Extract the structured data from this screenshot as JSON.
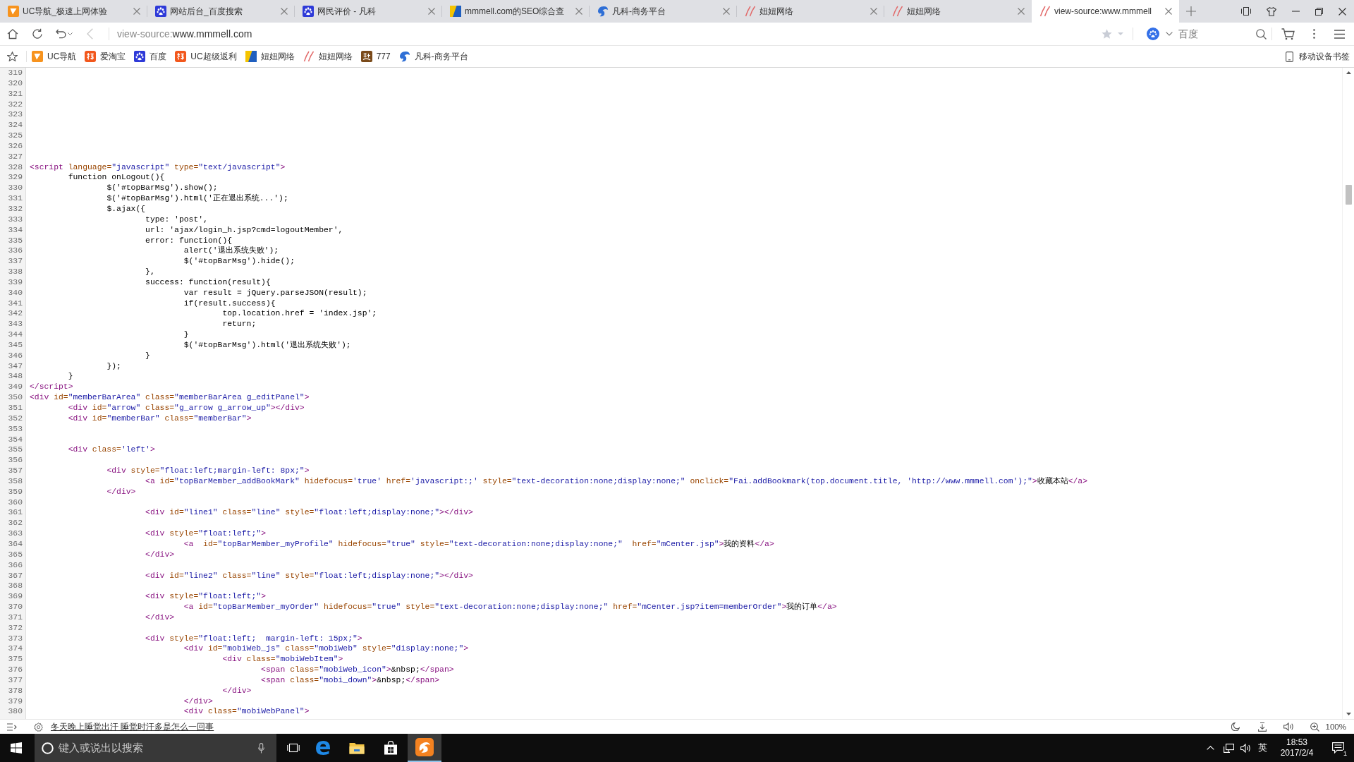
{
  "tabs": [
    {
      "title": "UC导航_极速上网体验",
      "selected": false
    },
    {
      "title": "网站后台_百度搜索",
      "selected": false
    },
    {
      "title": "网民评价 - 凡科",
      "selected": false
    },
    {
      "title": "mmmell.com的SEO综合查",
      "selected": false
    },
    {
      "title": "凡科-商务平台",
      "selected": false
    },
    {
      "title": "妞妞网络",
      "selected": false
    },
    {
      "title": "妞妞网络",
      "selected": false
    },
    {
      "title": "view-source:www.mmmell",
      "selected": true
    }
  ],
  "back_button": {
    "disabled": true
  },
  "address_bar": {
    "scheme": "view-source:",
    "host": "www.mmmell.com"
  },
  "page_star": {
    "bookmarked": false
  },
  "search_box": {
    "placeholder": "百度"
  },
  "bookmarks": [
    {
      "label": "UC导航"
    },
    {
      "label": "爱淘宝"
    },
    {
      "label": "百度"
    },
    {
      "label": "UC超级返利"
    },
    {
      "label": "妞妞网络"
    },
    {
      "label": "妞妞网络"
    },
    {
      "label": "777"
    },
    {
      "label": "凡科-商务平台"
    }
  ],
  "mobile_bookmarks": {
    "label": "移动设备书签"
  },
  "source_lines": [
    {
      "number": "319"
    },
    {
      "number": "320"
    },
    {
      "number": "321"
    },
    {
      "number": "322"
    },
    {
      "number": "323"
    },
    {
      "number": "324"
    },
    {
      "number": "325"
    },
    {
      "number": "326"
    },
    {
      "number": "327"
    },
    {
      "number": "328",
      "tokens": [
        {
          "kind": "tag",
          "text": "<script"
        },
        {
          "kind": "attr",
          "text": " language="
        },
        {
          "kind": "value",
          "text": "\"javascript\""
        },
        {
          "kind": "attr",
          "text": " type="
        },
        {
          "kind": "value",
          "text": "\"text/javascript\""
        },
        {
          "kind": "tag",
          "text": ">"
        }
      ]
    },
    {
      "number": "329",
      "tokens": [
        {
          "kind": "text",
          "text": "\tfunction onLogout(){"
        }
      ]
    },
    {
      "number": "330",
      "tokens": [
        {
          "kind": "text",
          "text": "\t\t$('#topBarMsg').show();"
        }
      ]
    },
    {
      "number": "331",
      "tokens": [
        {
          "kind": "text",
          "text": "\t\t$('#topBarMsg').html('正在退出系统...');"
        }
      ]
    },
    {
      "number": "332",
      "tokens": [
        {
          "kind": "text",
          "text": "\t\t$.ajax({"
        }
      ]
    },
    {
      "number": "333",
      "tokens": [
        {
          "kind": "text",
          "text": "\t\t\ttype: 'post',"
        }
      ]
    },
    {
      "number": "334",
      "tokens": [
        {
          "kind": "text",
          "text": "\t\t\turl: 'ajax/login_h.jsp?cmd=logoutMember',"
        }
      ]
    },
    {
      "number": "335",
      "tokens": [
        {
          "kind": "text",
          "text": "\t\t\terror: function(){"
        }
      ]
    },
    {
      "number": "336",
      "tokens": [
        {
          "kind": "text",
          "text": "\t\t\t\talert('退出系统失败');"
        }
      ]
    },
    {
      "number": "337",
      "tokens": [
        {
          "kind": "text",
          "text": "\t\t\t\t$('#topBarMsg').hide();"
        }
      ]
    },
    {
      "number": "338",
      "tokens": [
        {
          "kind": "text",
          "text": "\t\t\t},"
        }
      ]
    },
    {
      "number": "339",
      "tokens": [
        {
          "kind": "text",
          "text": "\t\t\tsuccess: function(result){"
        }
      ]
    },
    {
      "number": "340",
      "tokens": [
        {
          "kind": "text",
          "text": "\t\t\t\tvar result = jQuery.parseJSON(result);"
        }
      ]
    },
    {
      "number": "341",
      "tokens": [
        {
          "kind": "text",
          "text": "\t\t\t\tif(result.success){"
        }
      ]
    },
    {
      "number": "342",
      "tokens": [
        {
          "kind": "text",
          "text": "\t\t\t\t\ttop.location.href = 'index.jsp';"
        }
      ]
    },
    {
      "number": "343",
      "tokens": [
        {
          "kind": "text",
          "text": "\t\t\t\t\treturn;"
        }
      ]
    },
    {
      "number": "344",
      "tokens": [
        {
          "kind": "text",
          "text": "\t\t\t\t}"
        }
      ]
    },
    {
      "number": "345",
      "tokens": [
        {
          "kind": "text",
          "text": "\t\t\t\t$('#topBarMsg').html('退出系统失败');"
        }
      ]
    },
    {
      "number": "346",
      "tokens": [
        {
          "kind": "text",
          "text": "\t\t\t}"
        }
      ]
    },
    {
      "number": "347",
      "tokens": [
        {
          "kind": "text",
          "text": "\t\t});"
        }
      ]
    },
    {
      "number": "348",
      "tokens": [
        {
          "kind": "text",
          "text": "\t}"
        }
      ]
    },
    {
      "number": "349",
      "tokens": [
        {
          "kind": "tag",
          "text": "</script>"
        }
      ]
    },
    {
      "number": "350",
      "tokens": [
        {
          "kind": "tag",
          "text": "<div"
        },
        {
          "kind": "attr",
          "text": " id="
        },
        {
          "kind": "value",
          "text": "\"memberBarArea\""
        },
        {
          "kind": "attr",
          "text": " class="
        },
        {
          "kind": "value",
          "text": "\"memberBarArea g_editPanel\""
        },
        {
          "kind": "tag",
          "text": ">"
        }
      ]
    },
    {
      "number": "351",
      "tokens": [
        {
          "kind": "tag",
          "text": "\t<div"
        },
        {
          "kind": "attr",
          "text": " id="
        },
        {
          "kind": "value",
          "text": "\"arrow\""
        },
        {
          "kind": "attr",
          "text": " class="
        },
        {
          "kind": "value",
          "text": "\"g_arrow g_arrow_up\""
        },
        {
          "kind": "tag",
          "text": "></div>"
        }
      ]
    },
    {
      "number": "352",
      "tokens": [
        {
          "kind": "tag",
          "text": "\t<div"
        },
        {
          "kind": "attr",
          "text": " id="
        },
        {
          "kind": "value",
          "text": "\"memberBar\""
        },
        {
          "kind": "attr",
          "text": " class="
        },
        {
          "kind": "value",
          "text": "\"memberBar\""
        },
        {
          "kind": "tag",
          "text": ">"
        }
      ]
    },
    {
      "number": "353"
    },
    {
      "number": "354"
    },
    {
      "number": "355",
      "tokens": [
        {
          "kind": "tag",
          "text": "\t<div"
        },
        {
          "kind": "attr",
          "text": " class="
        },
        {
          "kind": "value",
          "text": "'left'"
        },
        {
          "kind": "tag",
          "text": ">"
        }
      ]
    },
    {
      "number": "356"
    },
    {
      "number": "357",
      "tokens": [
        {
          "kind": "tag",
          "text": "\t\t<div"
        },
        {
          "kind": "attr",
          "text": " style="
        },
        {
          "kind": "value",
          "text": "\"float:left;margin-left: 8px;\""
        },
        {
          "kind": "tag",
          "text": ">"
        }
      ]
    },
    {
      "number": "358",
      "tokens": [
        {
          "kind": "tag",
          "text": "\t\t\t<a"
        },
        {
          "kind": "attr",
          "text": " id="
        },
        {
          "kind": "value",
          "text": "\"topBarMember_addBookMark\""
        },
        {
          "kind": "attr",
          "text": " hidefocus="
        },
        {
          "kind": "value",
          "text": "'true'"
        },
        {
          "kind": "attr",
          "text": " href="
        },
        {
          "kind": "value",
          "text": "'javascript:;'"
        },
        {
          "kind": "attr",
          "text": " style="
        },
        {
          "kind": "value",
          "text": "\"text-decoration:none;display:none;\""
        },
        {
          "kind": "attr",
          "text": " onclick="
        },
        {
          "kind": "value",
          "text": "\"Fai.addBookmark(top.document.title, 'http://www.mmmell.com');\""
        },
        {
          "kind": "tag",
          "text": ">"
        },
        {
          "kind": "text",
          "text": "收藏本站"
        },
        {
          "kind": "tag",
          "text": "</a>"
        }
      ]
    },
    {
      "number": "359",
      "tokens": [
        {
          "kind": "tag",
          "text": "\t\t</div>"
        }
      ]
    },
    {
      "number": "360"
    },
    {
      "number": "361",
      "tokens": [
        {
          "kind": "tag",
          "text": "\t\t\t<div"
        },
        {
          "kind": "attr",
          "text": " id="
        },
        {
          "kind": "value",
          "text": "\"line1\""
        },
        {
          "kind": "attr",
          "text": " class="
        },
        {
          "kind": "value",
          "text": "\"line\""
        },
        {
          "kind": "attr",
          "text": " style="
        },
        {
          "kind": "value",
          "text": "\"float:left;display:none;\""
        },
        {
          "kind": "tag",
          "text": "></div>"
        }
      ]
    },
    {
      "number": "362"
    },
    {
      "number": "363",
      "tokens": [
        {
          "kind": "tag",
          "text": "\t\t\t<div"
        },
        {
          "kind": "attr",
          "text": " style="
        },
        {
          "kind": "value",
          "text": "\"float:left;\""
        },
        {
          "kind": "tag",
          "text": ">"
        }
      ]
    },
    {
      "number": "364",
      "tokens": [
        {
          "kind": "tag",
          "text": "\t\t\t\t<a"
        },
        {
          "kind": "attr",
          "text": "  id="
        },
        {
          "kind": "value",
          "text": "\"topBarMember_myProfile\""
        },
        {
          "kind": "attr",
          "text": " hidefocus="
        },
        {
          "kind": "value",
          "text": "\"true\""
        },
        {
          "kind": "attr",
          "text": " style="
        },
        {
          "kind": "value",
          "text": "\"text-decoration:none;display:none;\""
        },
        {
          "kind": "attr",
          "text": "  href="
        },
        {
          "kind": "value",
          "text": "\"mCenter.jsp\""
        },
        {
          "kind": "tag",
          "text": ">"
        },
        {
          "kind": "text",
          "text": "我的资料"
        },
        {
          "kind": "tag",
          "text": "</a>"
        }
      ]
    },
    {
      "number": "365",
      "tokens": [
        {
          "kind": "tag",
          "text": "\t\t\t</div>"
        }
      ]
    },
    {
      "number": "366"
    },
    {
      "number": "367",
      "tokens": [
        {
          "kind": "tag",
          "text": "\t\t\t<div"
        },
        {
          "kind": "attr",
          "text": " id="
        },
        {
          "kind": "value",
          "text": "\"line2\""
        },
        {
          "kind": "attr",
          "text": " class="
        },
        {
          "kind": "value",
          "text": "\"line\""
        },
        {
          "kind": "attr",
          "text": " style="
        },
        {
          "kind": "value",
          "text": "\"float:left;display:none;\""
        },
        {
          "kind": "tag",
          "text": "></div>"
        }
      ]
    },
    {
      "number": "368"
    },
    {
      "number": "369",
      "tokens": [
        {
          "kind": "tag",
          "text": "\t\t\t<div"
        },
        {
          "kind": "attr",
          "text": " style="
        },
        {
          "kind": "value",
          "text": "\"float:left;\""
        },
        {
          "kind": "tag",
          "text": ">"
        }
      ]
    },
    {
      "number": "370",
      "tokens": [
        {
          "kind": "tag",
          "text": "\t\t\t\t<a"
        },
        {
          "kind": "attr",
          "text": " id="
        },
        {
          "kind": "value",
          "text": "\"topBarMember_myOrder\""
        },
        {
          "kind": "attr",
          "text": " hidefocus="
        },
        {
          "kind": "value",
          "text": "\"true\""
        },
        {
          "kind": "attr",
          "text": " style="
        },
        {
          "kind": "value",
          "text": "\"text-decoration:none;display:none;\""
        },
        {
          "kind": "attr",
          "text": " href="
        },
        {
          "kind": "value",
          "text": "\"mCenter.jsp?item=memberOrder\""
        },
        {
          "kind": "tag",
          "text": ">"
        },
        {
          "kind": "text",
          "text": "我的订单"
        },
        {
          "kind": "tag",
          "text": "</a>"
        }
      ]
    },
    {
      "number": "371",
      "tokens": [
        {
          "kind": "tag",
          "text": "\t\t\t</div>"
        }
      ]
    },
    {
      "number": "372"
    },
    {
      "number": "373",
      "tokens": [
        {
          "kind": "tag",
          "text": "\t\t\t<div"
        },
        {
          "kind": "attr",
          "text": " style="
        },
        {
          "kind": "value",
          "text": "\"float:left;  margin-left: 15px;\""
        },
        {
          "kind": "tag",
          "text": ">"
        }
      ]
    },
    {
      "number": "374",
      "tokens": [
        {
          "kind": "tag",
          "text": "\t\t\t\t<div"
        },
        {
          "kind": "attr",
          "text": " id="
        },
        {
          "kind": "value",
          "text": "\"mobiWeb_js\""
        },
        {
          "kind": "attr",
          "text": " class="
        },
        {
          "kind": "value",
          "text": "\"mobiWeb\""
        },
        {
          "kind": "attr",
          "text": " style="
        },
        {
          "kind": "value",
          "text": "\"display:none;\""
        },
        {
          "kind": "tag",
          "text": ">"
        }
      ]
    },
    {
      "number": "375",
      "tokens": [
        {
          "kind": "tag",
          "text": "\t\t\t\t\t<div"
        },
        {
          "kind": "attr",
          "text": " class="
        },
        {
          "kind": "value",
          "text": "\"mobiWebItem\""
        },
        {
          "kind": "tag",
          "text": ">"
        }
      ]
    },
    {
      "number": "376",
      "tokens": [
        {
          "kind": "tag",
          "text": "\t\t\t\t\t\t<span"
        },
        {
          "kind": "attr",
          "text": " class="
        },
        {
          "kind": "value",
          "text": "\"mobiWeb_icon\""
        },
        {
          "kind": "tag",
          "text": ">"
        },
        {
          "kind": "text",
          "text": "&nbsp;"
        },
        {
          "kind": "tag",
          "text": "</span>"
        }
      ]
    },
    {
      "number": "377",
      "tokens": [
        {
          "kind": "tag",
          "text": "\t\t\t\t\t\t<span"
        },
        {
          "kind": "attr",
          "text": " class="
        },
        {
          "kind": "value",
          "text": "\"mobi_down\""
        },
        {
          "kind": "tag",
          "text": ">"
        },
        {
          "kind": "text",
          "text": "&nbsp;"
        },
        {
          "kind": "tag",
          "text": "</span>"
        }
      ]
    },
    {
      "number": "378",
      "tokens": [
        {
          "kind": "tag",
          "text": "\t\t\t\t\t</div>"
        }
      ]
    },
    {
      "number": "379",
      "tokens": [
        {
          "kind": "tag",
          "text": "\t\t\t\t</div>"
        }
      ]
    },
    {
      "number": "380",
      "tokens": [
        {
          "kind": "tag",
          "text": "\t\t\t\t<div"
        },
        {
          "kind": "attr",
          "text": " class="
        },
        {
          "kind": "value",
          "text": "\"mobiWebPanel\""
        },
        {
          "kind": "tag",
          "text": ">"
        }
      ]
    }
  ],
  "status_bar": {
    "news_link": "冬天晚上睡觉出汗 睡觉时汗多是怎么一回事",
    "zoom": "100%"
  },
  "taskbar": {
    "search": {
      "placeholder": "键入或说出以搜索"
    },
    "apps": [
      {
        "selected": false
      },
      {
        "selected": false
      },
      {
        "selected": false
      },
      {
        "selected": true
      }
    ],
    "input_language": "英",
    "time": "18:53",
    "date": "2017/2/4",
    "notification_count": "1"
  }
}
